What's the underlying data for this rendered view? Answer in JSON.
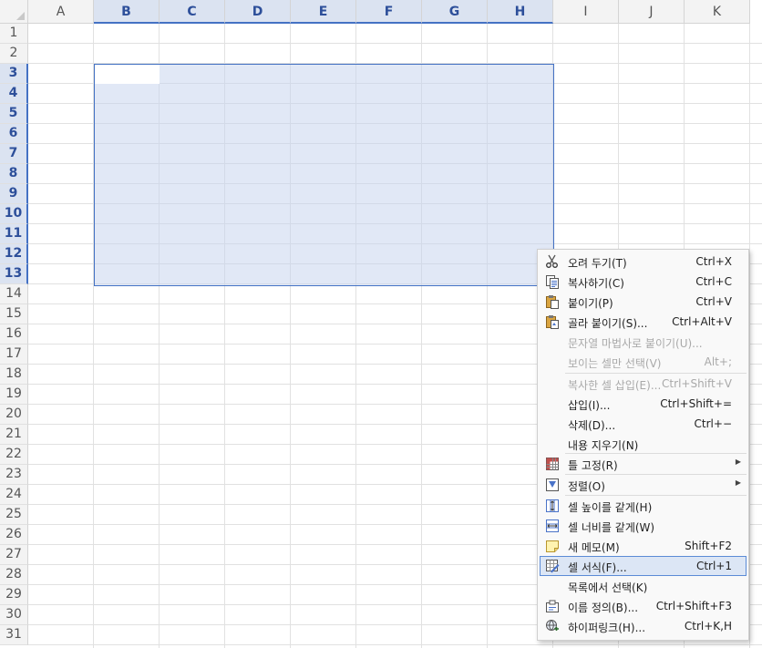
{
  "sheet": {
    "columns": [
      "A",
      "B",
      "C",
      "D",
      "E",
      "F",
      "G",
      "H",
      "I",
      "J",
      "K"
    ],
    "rows": [
      "1",
      "2",
      "3",
      "4",
      "5",
      "6",
      "7",
      "8",
      "9",
      "10",
      "11",
      "12",
      "13",
      "14",
      "15",
      "16",
      "17",
      "18",
      "19",
      "20",
      "21",
      "22",
      "23",
      "24",
      "25",
      "26",
      "27",
      "28",
      "29",
      "30",
      "31"
    ],
    "selected_columns": [
      "B",
      "C",
      "D",
      "E",
      "F",
      "G",
      "H"
    ],
    "selected_rows": [
      "3",
      "4",
      "5",
      "6",
      "7",
      "8",
      "9",
      "10",
      "11",
      "12",
      "13"
    ],
    "selection_color": "#4472c4"
  },
  "context_menu": {
    "items": [
      {
        "label": "오려 두기(T)",
        "shortcut": "Ctrl+X",
        "icon": "scissors-icon",
        "disabled": false
      },
      {
        "label": "복사하기(C)",
        "shortcut": "Ctrl+C",
        "icon": "copy-icon",
        "disabled": false
      },
      {
        "label": "붙이기(P)",
        "shortcut": "Ctrl+V",
        "icon": "paste-icon",
        "disabled": false
      },
      {
        "label": "골라 붙이기(S)...",
        "shortcut": "Ctrl+Alt+V",
        "icon": "paste-special-icon",
        "disabled": false
      },
      {
        "label": "문자열 마법사로 붙이기(U)...",
        "shortcut": "",
        "icon": "",
        "disabled": true
      },
      {
        "label": "보이는 셀만 선택(V)",
        "shortcut": "Alt+;",
        "icon": "",
        "disabled": true
      },
      {
        "label": "복사한 셀 삽입(E)...",
        "shortcut": "Ctrl+Shift+V",
        "icon": "",
        "disabled": true
      },
      {
        "label": "삽입(I)...",
        "shortcut": "Ctrl+Shift+=",
        "icon": "",
        "disabled": false
      },
      {
        "label": "삭제(D)...",
        "shortcut": "Ctrl+−",
        "icon": "",
        "disabled": false
      },
      {
        "label": "내용 지우기(N)",
        "shortcut": "",
        "icon": "",
        "disabled": false
      },
      {
        "label": "틀 고정(R)",
        "shortcut": "",
        "icon": "freeze-panes-icon",
        "disabled": false,
        "submenu": true
      },
      {
        "label": "정렬(O)",
        "shortcut": "",
        "icon": "sort-icon",
        "disabled": false,
        "submenu": true
      },
      {
        "label": "셀 높이를 같게(H)",
        "shortcut": "",
        "icon": "equal-height-icon",
        "disabled": false
      },
      {
        "label": "셀 너비를 같게(W)",
        "shortcut": "",
        "icon": "equal-width-icon",
        "disabled": false
      },
      {
        "label": "새 메모(M)",
        "shortcut": "Shift+F2",
        "icon": "memo-icon",
        "disabled": false
      },
      {
        "label": "셀 서식(F)...",
        "shortcut": "Ctrl+1",
        "icon": "cell-format-icon",
        "disabled": false,
        "highlighted": true
      },
      {
        "label": "목록에서 선택(K)",
        "shortcut": "",
        "icon": "",
        "disabled": false
      },
      {
        "label": "이름 정의(B)...",
        "shortcut": "Ctrl+Shift+F3",
        "icon": "define-name-icon",
        "disabled": false
      },
      {
        "label": "하이퍼링크(H)...",
        "shortcut": "Ctrl+K,H",
        "icon": "hyperlink-icon",
        "disabled": false
      }
    ]
  }
}
